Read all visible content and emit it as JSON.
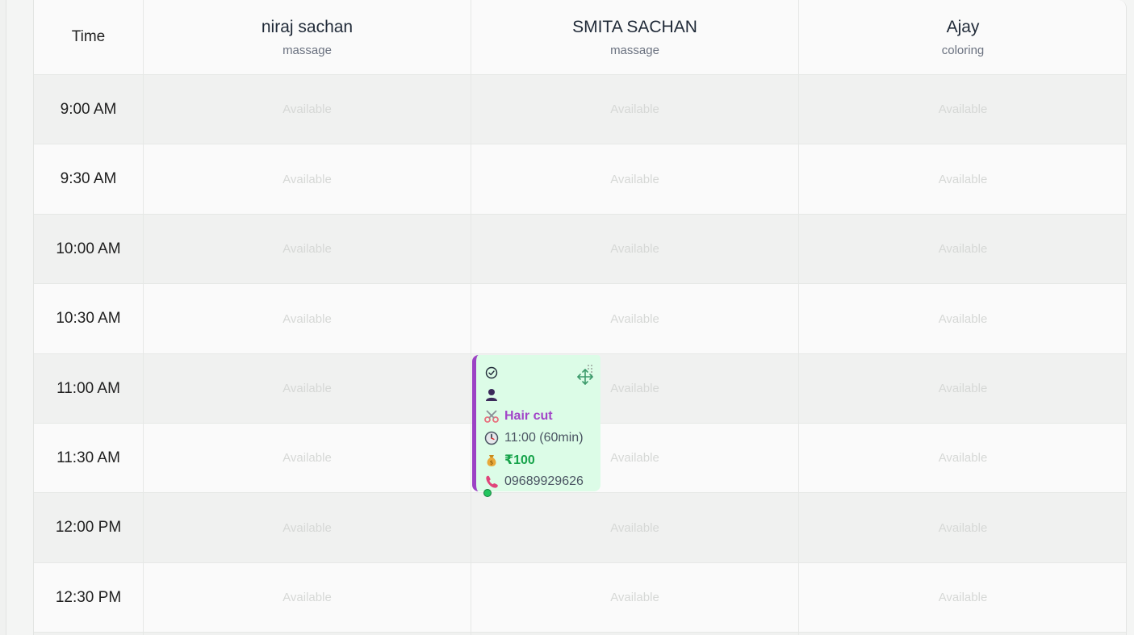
{
  "header": {
    "time_label": "Time",
    "staff": [
      {
        "name": "niraj sachan",
        "service": "massage"
      },
      {
        "name": "SMITA SACHAN",
        "service": "massage"
      },
      {
        "name": "Ajay",
        "service": "coloring"
      }
    ]
  },
  "slots": [
    {
      "time": "9:00 AM",
      "cells": [
        "Available",
        "Available",
        "Available"
      ]
    },
    {
      "time": "9:30 AM",
      "cells": [
        "Available",
        "Available",
        "Available"
      ]
    },
    {
      "time": "10:00 AM",
      "cells": [
        "Available",
        "Available",
        "Available"
      ]
    },
    {
      "time": "10:30 AM",
      "cells": [
        "Available",
        "Available",
        "Available"
      ]
    },
    {
      "time": "11:00 AM",
      "cells": [
        "Available",
        "Available",
        "Available"
      ]
    },
    {
      "time": "11:30 AM",
      "cells": [
        "Available",
        "Available",
        "Available"
      ]
    },
    {
      "time": "12:00 PM",
      "cells": [
        "Available",
        "Available",
        "Available"
      ]
    },
    {
      "time": "12:30 PM",
      "cells": [
        "Available",
        "Available",
        "Available"
      ]
    }
  ],
  "appointment": {
    "staff": "SMITA SACHAN",
    "service": "Hair cut",
    "time": "11:00 (60min)",
    "price": "₹100",
    "phone": "09689929626",
    "icons": [
      "check-circle-icon",
      "user-icon",
      "scissors-icon",
      "clock-icon",
      "money-bag-icon",
      "phone-icon",
      "move-icon"
    ],
    "colors": {
      "accent": "#9b42c4",
      "background": "#dcfce7",
      "price": "#16a34a",
      "status_dot": "#22c55e"
    }
  }
}
